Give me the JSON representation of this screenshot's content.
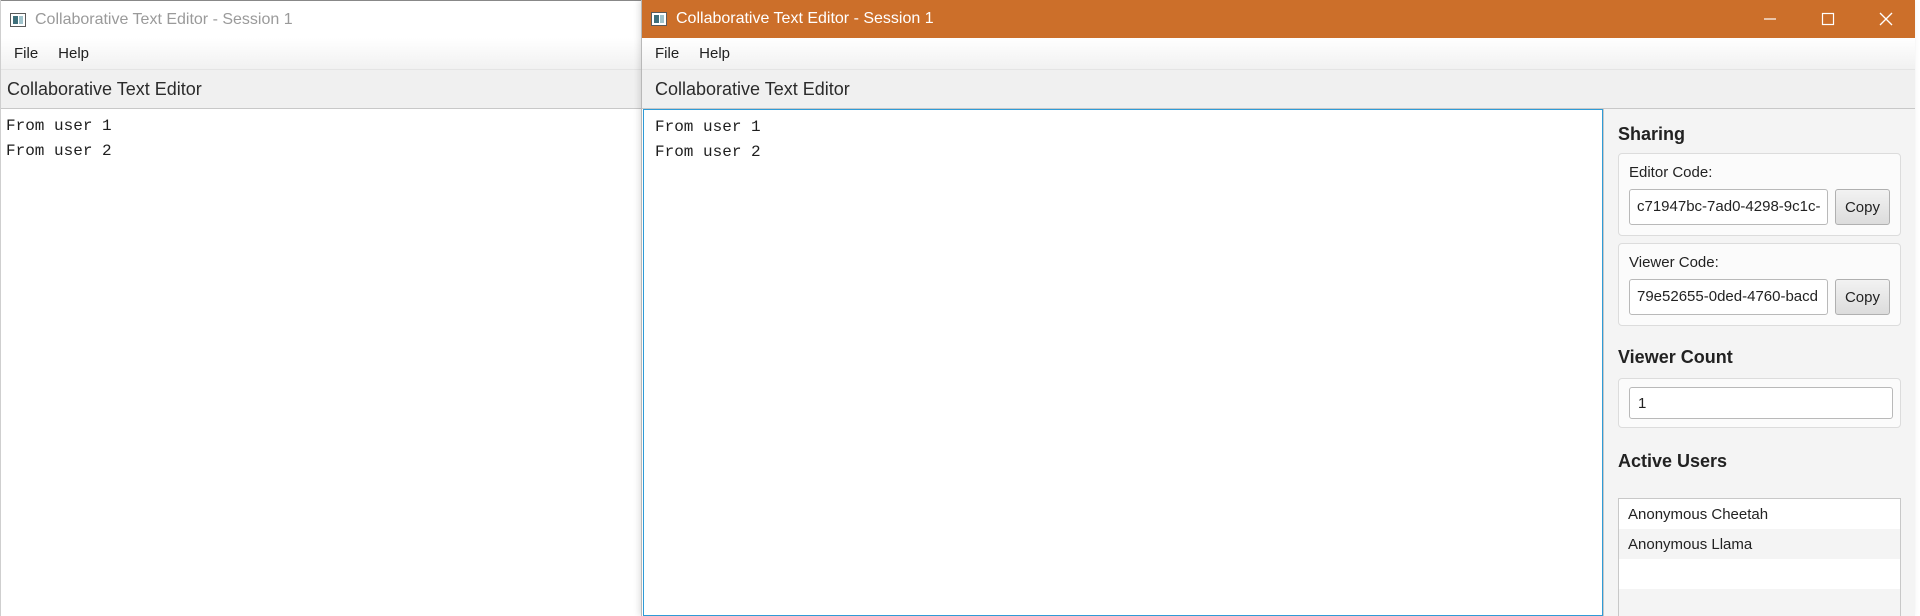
{
  "back_window": {
    "title": "Collaborative Text Editor - Session 1",
    "menu": [
      "File",
      "Help"
    ],
    "header": "Collaborative Text Editor",
    "editor_lines": [
      "From user 1",
      "From user 2"
    ]
  },
  "front_window": {
    "title": "Collaborative Text Editor - Session 1",
    "title_color": "#cc6f2a",
    "controls": [
      "minimize-icon",
      "maximize-icon",
      "close-icon"
    ],
    "menu": [
      "File",
      "Help"
    ],
    "header": "Collaborative Text Editor",
    "editor_lines": [
      "From user 1",
      "From user 2"
    ],
    "sharing": {
      "title": "Sharing",
      "editor_code_label": "Editor Code:",
      "editor_code": "c71947bc-7ad0-4298-9c1c-",
      "viewer_code_label": "Viewer Code:",
      "viewer_code": "79e52655-0ded-4760-bacd",
      "copy_label": "Copy"
    },
    "viewer_count": {
      "title": "Viewer Count",
      "value": "1"
    },
    "active_users": {
      "title": "Active Users",
      "users": [
        "Anonymous Cheetah",
        "Anonymous Llama"
      ]
    }
  }
}
